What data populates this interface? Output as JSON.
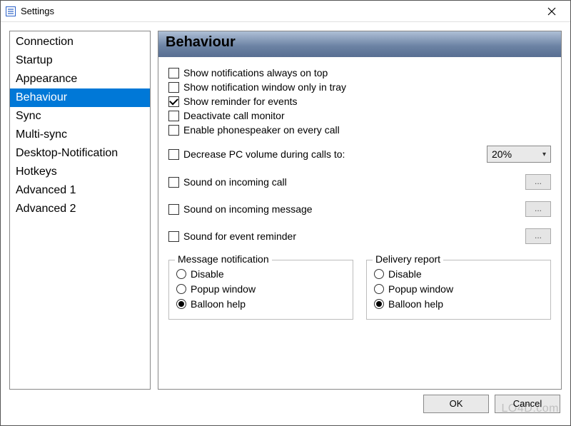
{
  "window": {
    "title": "Settings"
  },
  "sidebar": {
    "items": [
      {
        "label": "Connection",
        "selected": false
      },
      {
        "label": "Startup",
        "selected": false
      },
      {
        "label": "Appearance",
        "selected": false
      },
      {
        "label": "Behaviour",
        "selected": true
      },
      {
        "label": "Sync",
        "selected": false
      },
      {
        "label": "Multi-sync",
        "selected": false
      },
      {
        "label": "Desktop-Notification",
        "selected": false
      },
      {
        "label": "Hotkeys",
        "selected": false
      },
      {
        "label": "Advanced 1",
        "selected": false
      },
      {
        "label": "Advanced 2",
        "selected": false
      }
    ]
  },
  "panel": {
    "header": "Behaviour",
    "checks": {
      "always_on_top": {
        "label": "Show notifications always on top",
        "checked": false
      },
      "only_in_tray": {
        "label": "Show notification window only in tray",
        "checked": false
      },
      "reminder_events": {
        "label": "Show reminder for events",
        "checked": true
      },
      "deactivate_call_monitor": {
        "label": "Deactivate call monitor",
        "checked": false
      },
      "phonespeaker": {
        "label": "Enable phonespeaker on every call",
        "checked": false
      },
      "decrease_volume": {
        "label": "Decrease PC volume during calls to:",
        "checked": false
      },
      "sound_incoming_call": {
        "label": "Sound on incoming call",
        "checked": false
      },
      "sound_incoming_message": {
        "label": "Sound on incoming message",
        "checked": false
      },
      "sound_event_reminder": {
        "label": "Sound for event reminder",
        "checked": false
      }
    },
    "volume_select": {
      "value": "20%"
    },
    "browse_label": "...",
    "groups": {
      "message_notification": {
        "legend": "Message notification",
        "options": [
          {
            "label": "Disable",
            "selected": false
          },
          {
            "label": "Popup window",
            "selected": false
          },
          {
            "label": "Balloon help",
            "selected": true
          }
        ]
      },
      "delivery_report": {
        "legend": "Delivery report",
        "options": [
          {
            "label": "Disable",
            "selected": false
          },
          {
            "label": "Popup window",
            "selected": false
          },
          {
            "label": "Balloon help",
            "selected": true
          }
        ]
      }
    }
  },
  "footer": {
    "ok": "OK",
    "cancel": "Cancel"
  },
  "watermark": "LO4D.com"
}
